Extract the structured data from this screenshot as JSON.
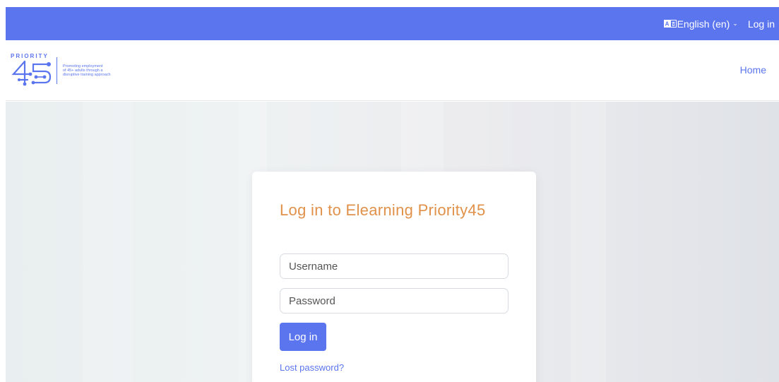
{
  "topbar": {
    "language_label": "English (en)",
    "language_icon": "language-icon",
    "chevron_icon": "chevron-down-icon",
    "login_label": "Log in",
    "color": "#5b75ef"
  },
  "navbar": {
    "logo_word": "PRIORITY",
    "tagline": [
      "Promoting employment",
      "of 45+ adults through a",
      "disruptive training approach"
    ],
    "home_label": "Home"
  },
  "login": {
    "title": "Log in to Elearning Priority45",
    "username_placeholder": "Username",
    "password_placeholder": "Password",
    "submit_label": "Log in",
    "lost_password_label": "Lost password?",
    "title_color": "#e0914a"
  }
}
